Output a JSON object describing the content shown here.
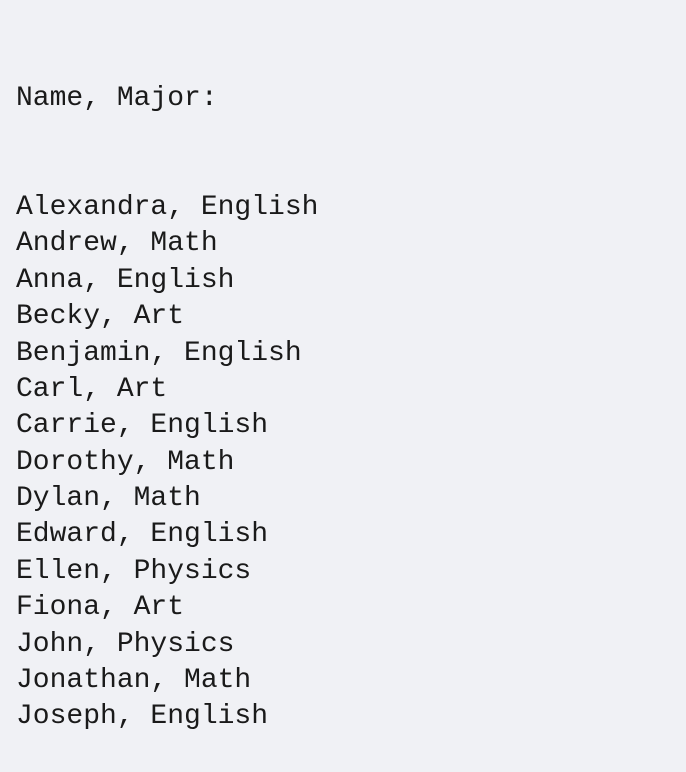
{
  "header": "Name, Major:",
  "rows": [
    {
      "name": "Alexandra",
      "major": "English"
    },
    {
      "name": "Andrew",
      "major": "Math"
    },
    {
      "name": "Anna",
      "major": "English"
    },
    {
      "name": "Becky",
      "major": "Art"
    },
    {
      "name": "Benjamin",
      "major": "English"
    },
    {
      "name": "Carl",
      "major": "Art"
    },
    {
      "name": "Carrie",
      "major": "English"
    },
    {
      "name": "Dorothy",
      "major": "Math"
    },
    {
      "name": "Dylan",
      "major": "Math"
    },
    {
      "name": "Edward",
      "major": "English"
    },
    {
      "name": "Ellen",
      "major": "Physics"
    },
    {
      "name": "Fiona",
      "major": "Art"
    },
    {
      "name": "John",
      "major": "Physics"
    },
    {
      "name": "Jonathan",
      "major": "Math"
    },
    {
      "name": "Joseph",
      "major": "English"
    }
  ]
}
